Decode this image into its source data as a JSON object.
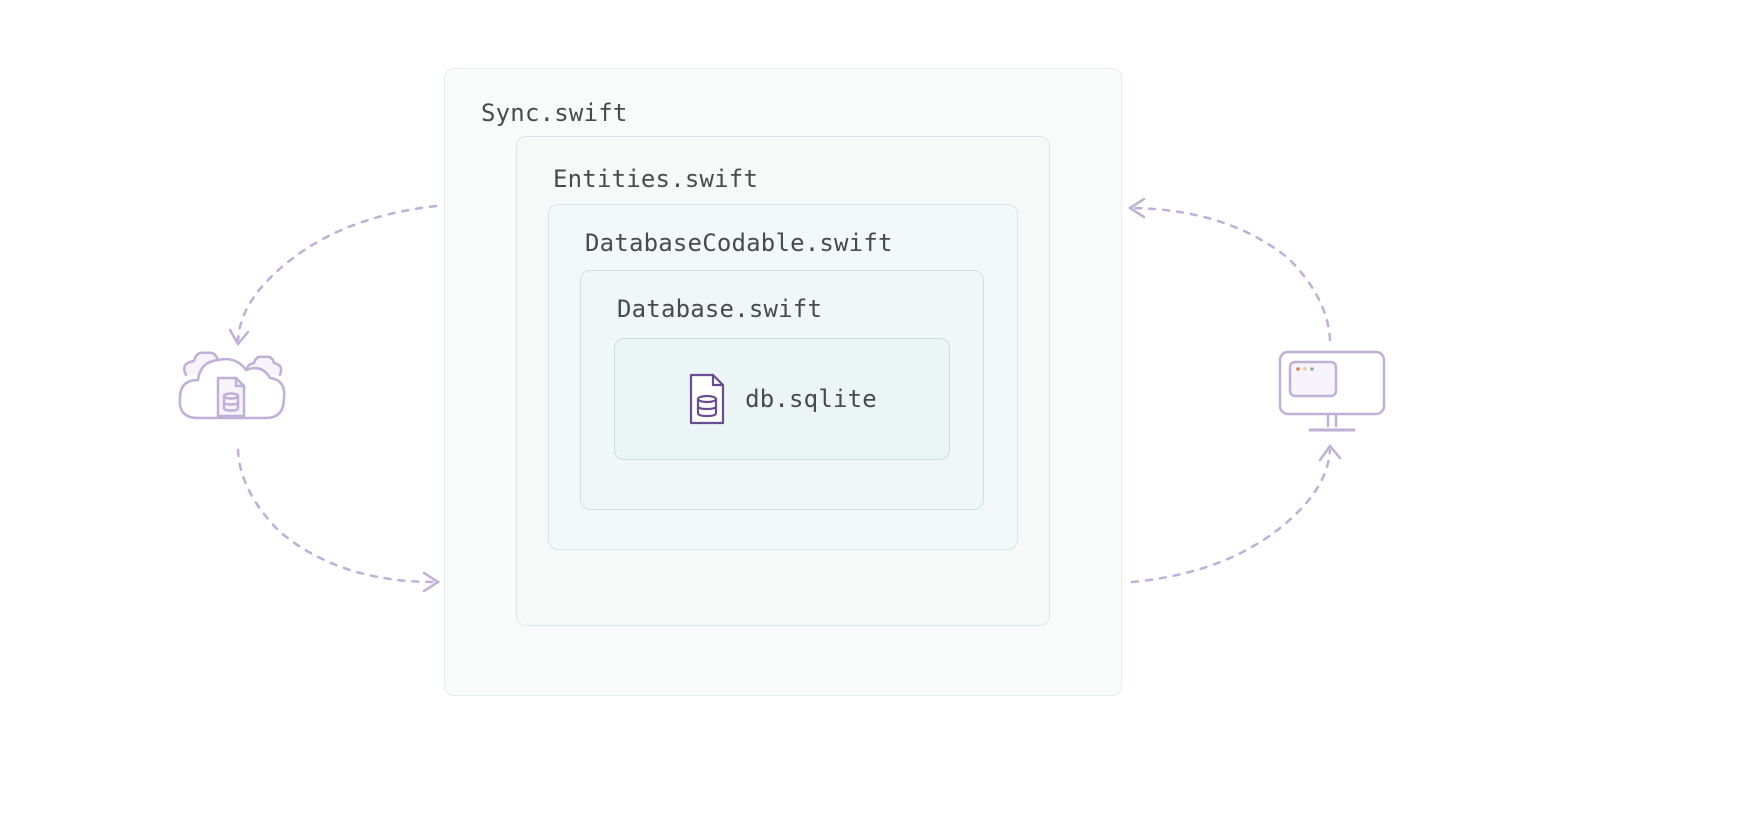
{
  "boxes": {
    "sync": {
      "label": "Sync.swift"
    },
    "entities": {
      "label": "Entities.swift"
    },
    "dbcodable": {
      "label": "DatabaseCodable.swift"
    },
    "database": {
      "label": "Database.swift"
    },
    "sqlite": {
      "label": "db.sqlite"
    }
  },
  "colors": {
    "arrow": "#c0afd6",
    "icon_stroke": "#c0afd6",
    "sqlite_icon": "#6a4c93",
    "label": "#4a4a4a"
  }
}
